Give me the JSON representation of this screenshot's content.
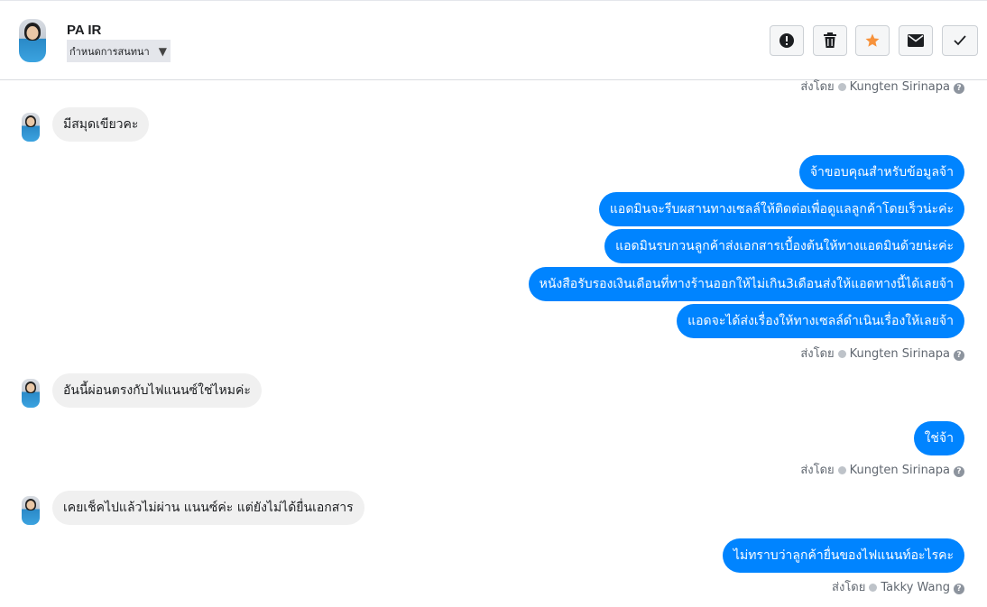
{
  "header": {
    "contact_name": "PA IR",
    "assign_label": "กำหนดการสนทนา",
    "actions": [
      {
        "name": "mark-spam",
        "icon": "exclamation-icon"
      },
      {
        "name": "delete",
        "icon": "trash-icon"
      },
      {
        "name": "star",
        "icon": "star-icon",
        "color": "#f7923b"
      },
      {
        "name": "mark-unread",
        "icon": "envelope-icon"
      },
      {
        "name": "mark-done",
        "icon": "checkmark-icon"
      }
    ]
  },
  "conversation": {
    "sent_by_prefix": "ส่งโดย",
    "help_glyph": "?",
    "sent_by_top": "Kungten Sirinapa",
    "incoming_1": "มีสมุดเขียวคะ",
    "outgoing_group_1": [
      "จ้าขอบคุณสำหรับข้อมูลจ้า",
      "แอดมินจะรีบผสานทางเซลล์ให้ติดต่อเพื่อดูแลลูกค้าโดยเร็วน่ะค่ะ",
      "แอดมินรบกวนลูกค้าส่งเอกสารเบื้องต้นให้ทางแอดมินด้วยน่ะค่ะ",
      "หนังสือรับรองเงินเดือนที่ทางร้านออกให้ไม่เกิน3เดือนส่งให้แอดทางนี้ได้เลยจ้า",
      "แอดจะได้ส่งเรื่องให้ทางเซลล์ดำเนินเรื่องให้เลยจ้า"
    ],
    "sent_by_1": "Kungten Sirinapa",
    "incoming_2": "อันนี้ผ่อนตรงกับไฟแนนซ์ใช่ไหมค่ะ",
    "outgoing_2": "ใช่จ้า",
    "sent_by_2": "Kungten Sirinapa",
    "incoming_3": "เคยเช็คไปแล้วไม่ผ่าน แนนซ์ค่ะ แต่ยังไม่ได้ยื่นเอกสาร",
    "outgoing_3": "ไม่ทราบว่าลูกค้ายื่นของไฟแนนท์อะไรคะ",
    "sent_by_3": "Takky Wang"
  },
  "colors": {
    "outgoing_bubble": "#0084ff",
    "incoming_bubble": "#f0f0f0",
    "star": "#f7923b"
  }
}
